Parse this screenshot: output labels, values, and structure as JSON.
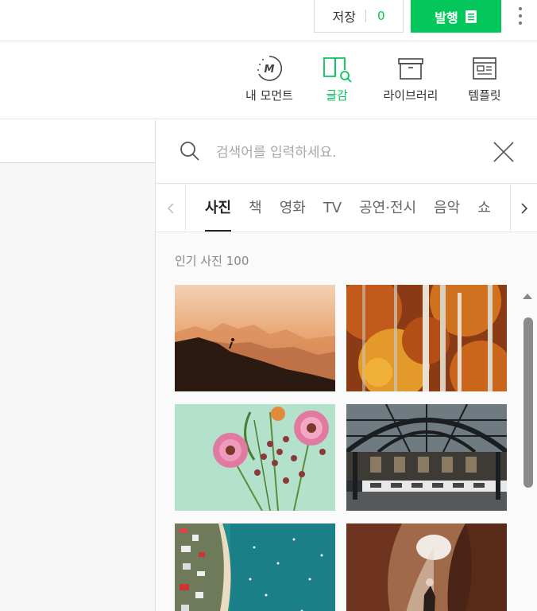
{
  "header": {
    "save_label": "저장",
    "save_count": "0",
    "publish_label": "발행"
  },
  "toolbar": {
    "items": [
      {
        "label": "내 모먼트",
        "icon": "moment-icon"
      },
      {
        "label": "글감",
        "icon": "book-search-icon",
        "active": true
      },
      {
        "label": "라이브러리",
        "icon": "archive-box-icon"
      },
      {
        "label": "템플릿",
        "icon": "template-icon"
      }
    ]
  },
  "panel": {
    "search_placeholder": "검색어를 입력하세요.",
    "tabs": [
      "사진",
      "책",
      "영화",
      "TV",
      "공연·전시",
      "음악",
      "쇼"
    ],
    "active_tab": "사진",
    "section_title": "인기 사진 100"
  },
  "colors": {
    "accent": "#03c75a",
    "count": "#00c73c"
  }
}
